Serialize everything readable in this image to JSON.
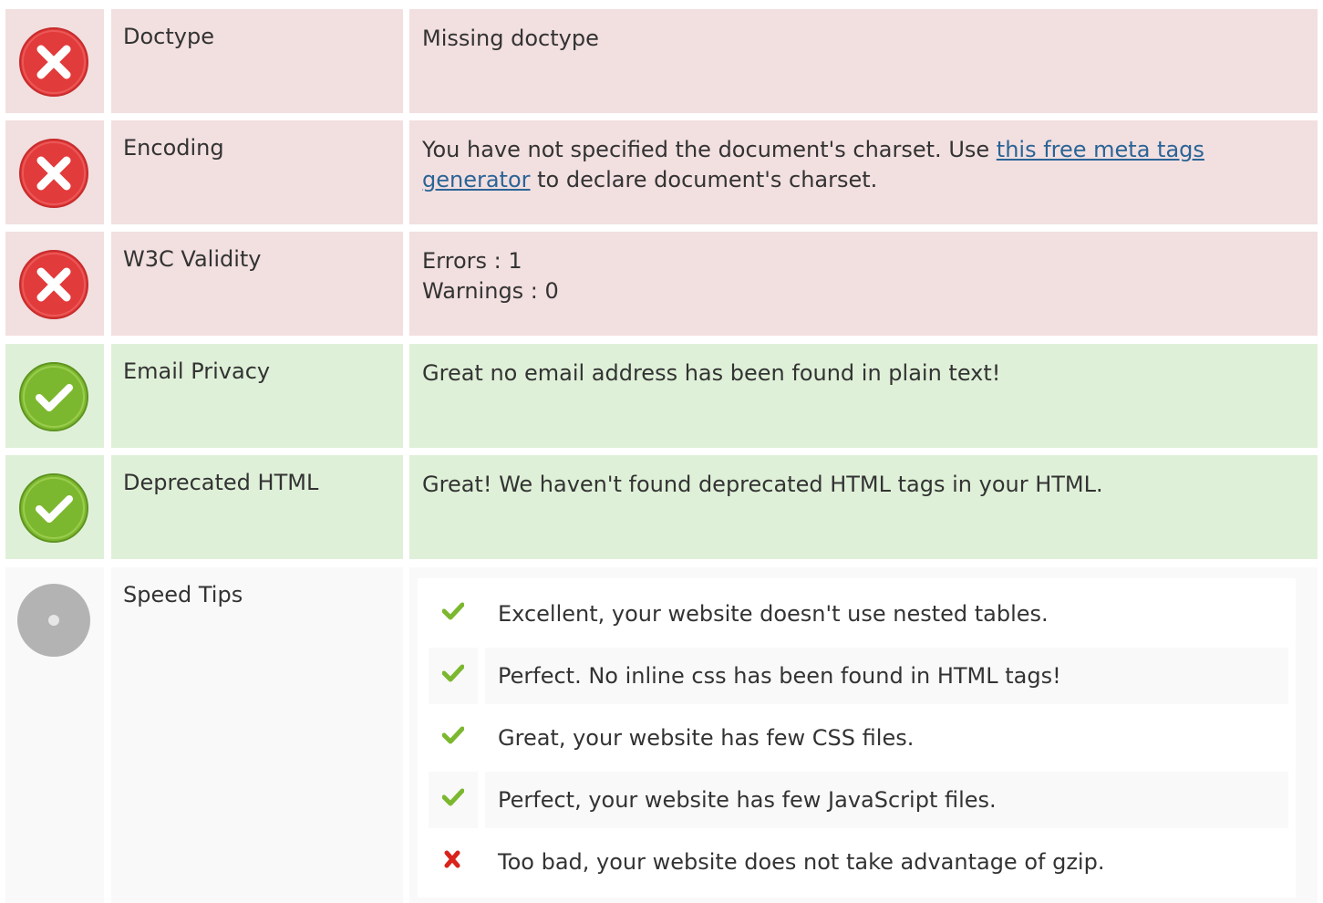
{
  "rows": [
    {
      "status": "error",
      "icon": "error-icon",
      "label": "Doctype",
      "value": "Missing doctype"
    },
    {
      "status": "error",
      "icon": "error-icon",
      "label": "Encoding",
      "value_before": "You have not specified the document's charset. Use ",
      "link_text": "this free meta tags generator",
      "value_after": " to declare document's charset."
    },
    {
      "status": "error",
      "icon": "error-icon",
      "label": "W3C Validity",
      "errors": "Errors : 1",
      "warnings": "Warnings : 0"
    },
    {
      "status": "ok",
      "icon": "check-circle-icon",
      "label": "Email Privacy",
      "value": "Great no email address has been found in plain text!"
    },
    {
      "status": "ok",
      "icon": "check-circle-icon",
      "label": "Deprecated HTML",
      "value": "Great! We haven't found deprecated HTML tags in your HTML."
    },
    {
      "status": "info",
      "icon": "neutral-circle-icon",
      "label": "Speed Tips"
    }
  ],
  "speed_tips": [
    {
      "icon": "check-icon",
      "text": "Excellent, your website doesn't use nested tables."
    },
    {
      "icon": "check-icon",
      "text": "Perfect. No inline css has been found in HTML tags!"
    },
    {
      "icon": "check-icon",
      "text": "Great, your website has few CSS files."
    },
    {
      "icon": "check-icon",
      "text": "Perfect, your website has few JavaScript files."
    },
    {
      "icon": "cross-icon",
      "text": "Too bad, your website does not take advantage of gzip."
    }
  ],
  "colors": {
    "error_bg": "#f2dfe0",
    "ok_bg": "#dff0d8",
    "info_bg": "#f9f9f9",
    "error_icon": "#e23b3b",
    "ok_icon": "#7cb82f",
    "neutral_icon": "#b3b3b3",
    "check": "#7cb82f",
    "cross": "#d9231b",
    "link": "#2a6496"
  }
}
